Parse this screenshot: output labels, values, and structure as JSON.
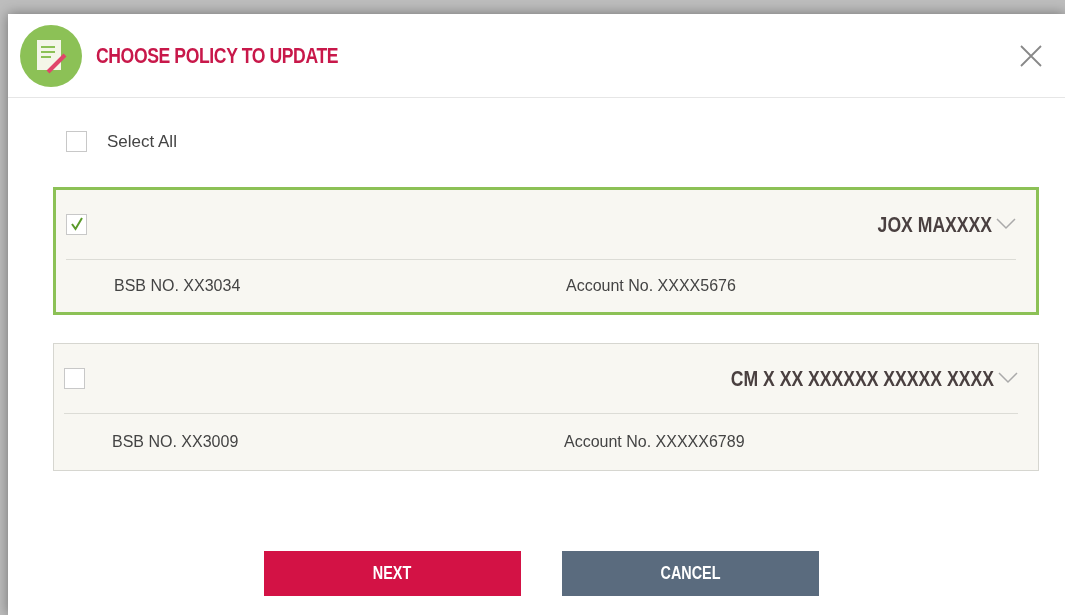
{
  "dialog": {
    "title": "CHOOSE POLICY TO UPDATE"
  },
  "select_all": {
    "label": "Select All",
    "checked": false
  },
  "policies": [
    {
      "name": "JOX MAXXXX",
      "checked": true,
      "bsb": "BSB NO. XX3034",
      "account": "Account No. XXXX5676"
    },
    {
      "name": "CM X XX XXXXXX XXXXX XXXX",
      "checked": false,
      "bsb": "BSB NO. XX3009",
      "account": "Account No. XXXXX6789"
    }
  ],
  "buttons": [
    {
      "label": "NEXT",
      "kind": "primary"
    },
    {
      "label": "CANCEL",
      "kind": "secondary"
    }
  ]
}
